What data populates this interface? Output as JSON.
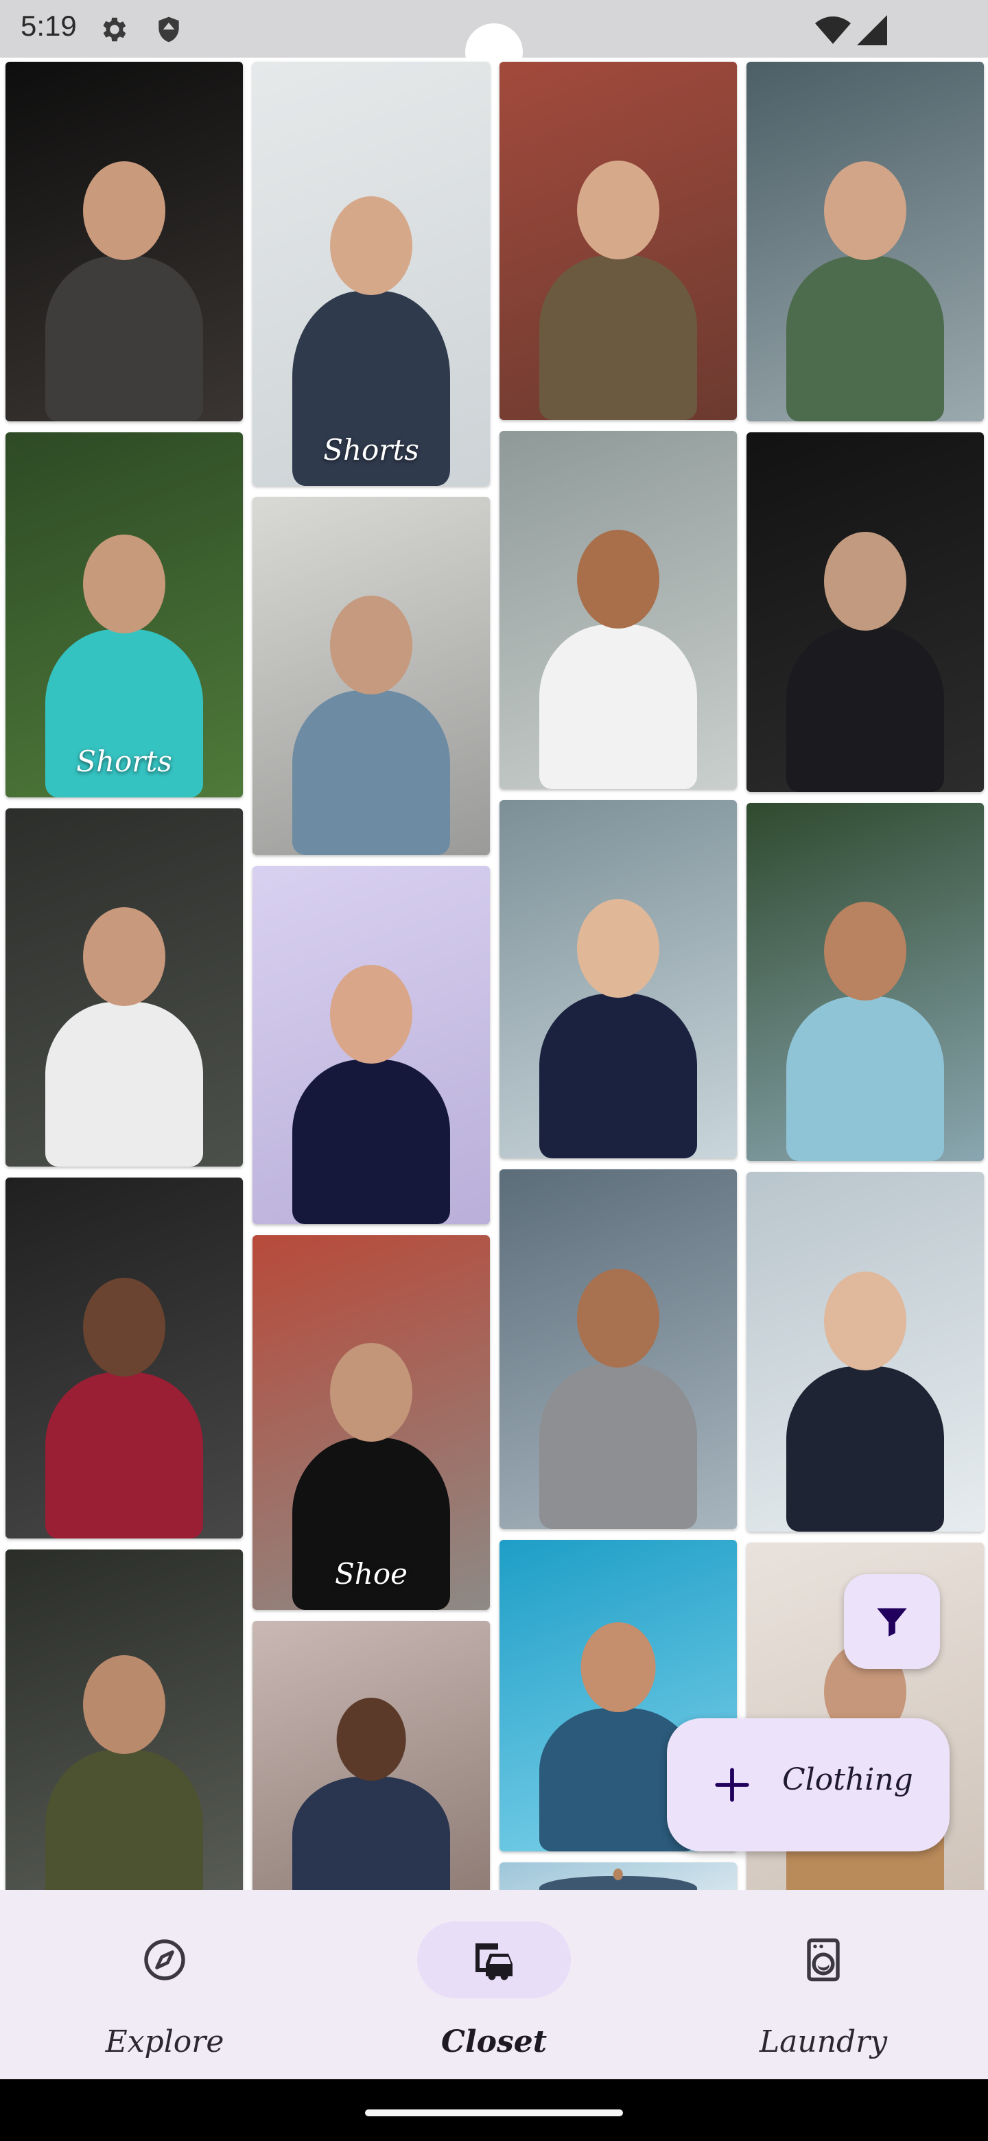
{
  "status_bar": {
    "time": "5:19",
    "icons": [
      "gear-icon",
      "shield-icon",
      "wifi-icon",
      "signal-icon"
    ]
  },
  "closet": {
    "columns": [
      [
        {
          "name": "photo-man-dark-knit-sweater",
          "caption": "",
          "bg": [
            "#0e0e0e",
            "#3a3532"
          ],
          "skin": "#c99a7c",
          "shirt": "#3f3d3c"
        },
        {
          "name": "photo-man-turquoise-sweater-plants",
          "caption": "Shorts",
          "bg": [
            "#2d4a25",
            "#4f7a3a"
          ],
          "skin": "#c79a7b",
          "shirt": "#35c3c2"
        },
        {
          "name": "photo-man-white-tshirt",
          "caption": "",
          "bg": [
            "#2c2e2b",
            "#4c504a"
          ],
          "skin": "#c8997c",
          "shirt": "#ececec"
        },
        {
          "name": "photo-man-red-sweater",
          "caption": "",
          "bg": [
            "#202020",
            "#474747"
          ],
          "skin": "#6a4430",
          "shirt": "#9a1e34"
        },
        {
          "name": "photo-man-olive-tshirt-beard",
          "caption": "",
          "bg": [
            "#2a2d28",
            "#5b5f58"
          ],
          "skin": "#b98a6c",
          "shirt": "#4d5330"
        }
      ],
      [
        {
          "name": "photo-man-navy-sleeveless",
          "caption": "Shorts",
          "bg": [
            "#e6e9ea",
            "#cdd3d6"
          ],
          "skin": "#d6a88a",
          "shirt": "#2f3a4d"
        },
        {
          "name": "photo-man-skateboard-beach",
          "caption": "",
          "bg": [
            "#d9d9d6",
            "#9a9a98"
          ],
          "skin": "#c69a7e",
          "shirt": "#6d8ca3"
        },
        {
          "name": "photo-man-black-shirt-lilac",
          "caption": "",
          "bg": [
            "#d9d1f0",
            "#b9afd9"
          ],
          "skin": "#d9a68a",
          "shirt": "#15183a"
        },
        {
          "name": "photo-man-black-suit-street",
          "caption": "Shoe",
          "bg": [
            "#b84a3a",
            "#8d8a86"
          ],
          "skin": "#c3967a",
          "shirt": "#111111"
        },
        {
          "name": "photo-man-laughing-stone-wall",
          "caption": "",
          "bg": [
            "#c9b8b4",
            "#8c7a73"
          ],
          "skin": "#5b3a29",
          "shirt": "#2a3550"
        }
      ],
      [
        {
          "name": "photo-man-brown-jacket-brick",
          "caption": "",
          "bg": [
            "#a24a3c",
            "#6c3a30"
          ],
          "skin": "#d7a98b",
          "shirt": "#6b5a40"
        },
        {
          "name": "photo-man-white-vneck-smile",
          "caption": "",
          "bg": [
            "#8f9a98",
            "#c9cfcd"
          ],
          "skin": "#a96e4a",
          "shirt": "#f2f2f2"
        },
        {
          "name": "photo-man-navy-suit-tunnel",
          "caption": "",
          "bg": [
            "#7c8f97",
            "#c9d6db"
          ],
          "skin": "#e0b898",
          "shirt": "#1b2240"
        },
        {
          "name": "photo-man-gray-tshirt-city",
          "caption": "",
          "bg": [
            "#5c6d7a",
            "#a7b5be"
          ],
          "skin": "#a8714f",
          "shirt": "#8d8f92"
        },
        {
          "name": "photo-man-denim-shirt-blue",
          "caption": "",
          "bg": [
            "#1e9ec7",
            "#7fd2ea"
          ],
          "skin": "#c58e6d",
          "shirt": "#2b5a7a"
        },
        {
          "name": "photo-man-partial",
          "caption": "",
          "bg": [
            "#9dc6d9",
            "#dbe8ef"
          ],
          "skin": "#b5845f",
          "shirt": "#3e5770"
        }
      ],
      [
        {
          "name": "photo-man-green-hoodie",
          "caption": "",
          "bg": [
            "#4c5f66",
            "#9aa9ae"
          ],
          "skin": "#d2a488",
          "shirt": "#4d6b4d"
        },
        {
          "name": "photo-man-dark-suit-red-tie",
          "caption": "",
          "bg": [
            "#121212",
            "#2c2c2c"
          ],
          "skin": "#c19a80",
          "shirt": "#1a1a1f"
        },
        {
          "name": "photo-man-light-blue-tshirt",
          "caption": "",
          "bg": [
            "#2f4a2e",
            "#8aa6b0"
          ],
          "skin": "#b98260",
          "shirt": "#8fc3d6"
        },
        {
          "name": "photo-man-glasses-blazer",
          "caption": "",
          "bg": [
            "#b9c5cc",
            "#e6ecef"
          ],
          "skin": "#e0b89c",
          "shirt": "#1e2433"
        },
        {
          "name": "photo-man-tan-jacket",
          "caption": "",
          "bg": [
            "#e9e2dc",
            "#cfc3b9"
          ],
          "skin": "#c6977a",
          "shirt": "#b98a5a"
        }
      ]
    ],
    "card_heights": [
      [
        524,
        532,
        522,
        526,
        540
      ],
      [
        618,
        522,
        522,
        546,
        420
      ],
      [
        522,
        522,
        522,
        524,
        454,
        60
      ],
      [
        524,
        524,
        522,
        524,
        524
      ]
    ]
  },
  "fab_filter": {
    "icon": "filter-icon"
  },
  "fab_add": {
    "label": "Clothing",
    "icon": "plus-icon"
  },
  "bottom_nav": {
    "items": [
      {
        "label": "Explore",
        "icon": "compass-icon",
        "active": false
      },
      {
        "label": "Closet",
        "icon": "wardrobe-icon",
        "active": true
      },
      {
        "label": "Laundry",
        "icon": "washing-machine-icon",
        "active": false
      }
    ]
  },
  "colors": {
    "fab_bg": "#ece3fb",
    "nav_bg": "#f1ebf5",
    "active_indicator": "#e8def8",
    "icon_tint": "#21005d"
  }
}
